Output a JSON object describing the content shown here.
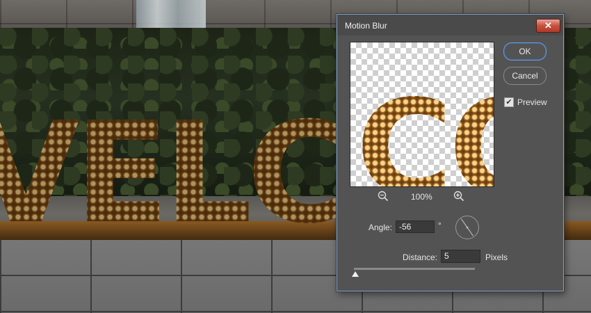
{
  "dialog": {
    "title": "Motion Blur",
    "close_glyph": "✕",
    "ok_label": "OK",
    "cancel_label": "Cancel",
    "preview_label": "Preview",
    "preview_checked": true,
    "zoom_out_icon": "zoom-out-icon",
    "zoom_in_icon": "zoom-in-icon",
    "zoom_level": "100%",
    "preview_text": "CO",
    "angle_label": "Angle:",
    "angle_value": "-56",
    "degree_symbol": "°",
    "distance_label": "Distance:",
    "distance_value": "5",
    "distance_unit": "Pixels",
    "distance_slider_fraction": 0.01
  },
  "background": {
    "sign_text": "VELCO"
  },
  "colors": {
    "dialog_bg": "#535353",
    "ok_border": "#6f9bd6",
    "close_button": "#c8503e",
    "gold": "#c48a3a"
  }
}
